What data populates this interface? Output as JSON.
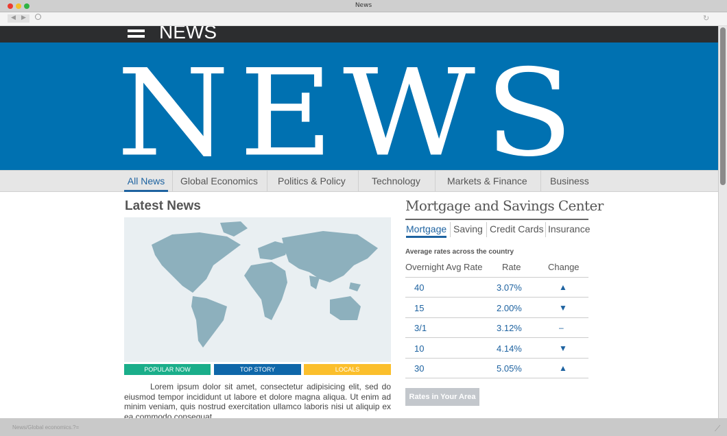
{
  "window": {
    "title": "News"
  },
  "header": {
    "small_logo": "NEWS",
    "banner": "NEWS"
  },
  "nav": {
    "items": [
      {
        "label": "All News",
        "active": true
      },
      {
        "label": "Global Economics"
      },
      {
        "label": "Politics & Policy"
      },
      {
        "label": "Technology"
      },
      {
        "label": "Markets & Finance"
      },
      {
        "label": "Business"
      }
    ]
  },
  "latest": {
    "title": "Latest News",
    "tags": [
      {
        "label": "POPULAR NOW",
        "color": "#1aae8a"
      },
      {
        "label": "TOP STORY",
        "color": "#0f67a9"
      },
      {
        "label": "LOCALS",
        "color": "#fbbf2c"
      }
    ],
    "body": "Lorem ipsum dolor sit amet, consectetur adipisicing  elit,  sed  do eiusmod  tempor  incididunt ut labore et dolore magna aliqua. Ut enim ad minim veniam, quis nostrud exercitation ullamco laboris nisi ut aliquip ex ea commodo consequat."
  },
  "mortgage": {
    "title": "Mortgage and Savings Center",
    "tabs": [
      "Mortgage",
      "Saving",
      "Credit Cards",
      "Insurance"
    ],
    "subtitle": "Average rates across the country",
    "columns": [
      "Overnight Avg Rate",
      "Rate",
      "Change"
    ],
    "rows": [
      {
        "term": "40",
        "rate": "3.07%",
        "change": "up",
        "glyph": "▲"
      },
      {
        "term": "15",
        "rate": "2.00%",
        "change": "down",
        "glyph": "▼"
      },
      {
        "term": "3/1",
        "rate": "3.12%",
        "change": "flat",
        "glyph": "–"
      },
      {
        "term": "10",
        "rate": "4.14%",
        "change": "down",
        "glyph": "▼"
      },
      {
        "term": "30",
        "rate": "5.05%",
        "change": "up",
        "glyph": "▲"
      }
    ],
    "button": "Rates in Your Area"
  },
  "status": {
    "url": "News/Global economics.?="
  },
  "colors": {
    "brand": "#0071b1",
    "accent": "#1d62a0"
  }
}
